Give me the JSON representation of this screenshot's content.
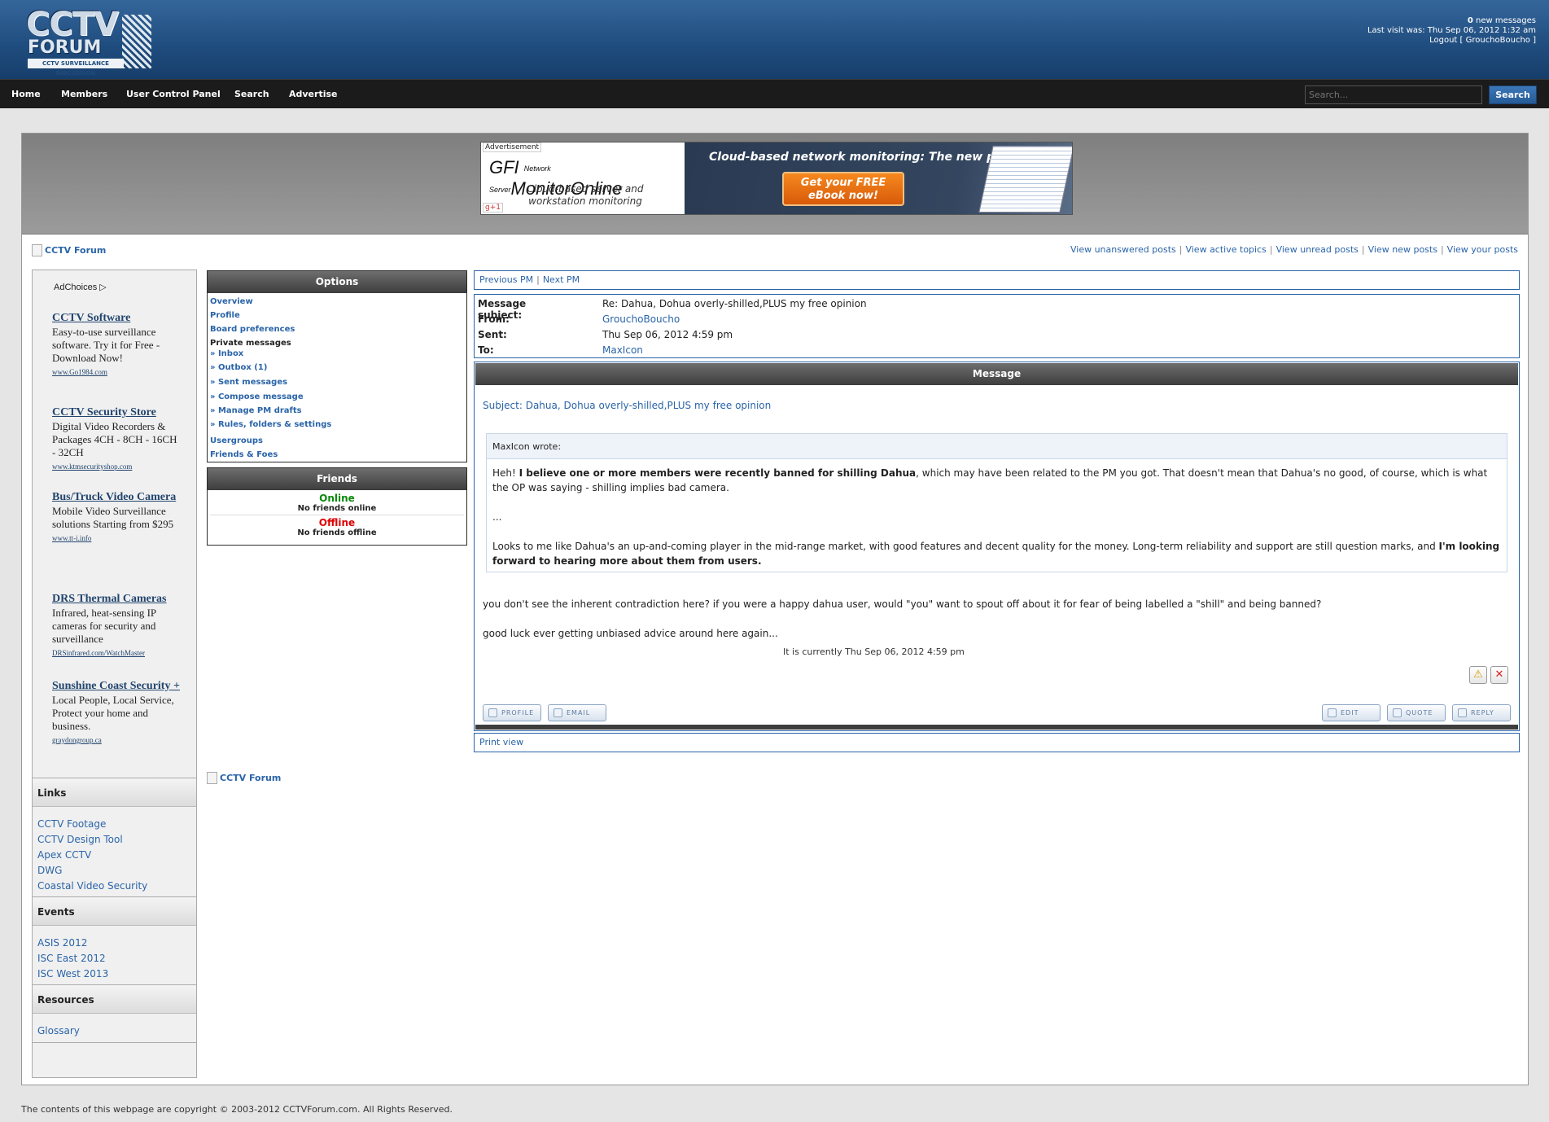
{
  "header": {
    "logo_main": "CCTV",
    "logo_sub": "FORUM",
    "logo_tag": "CCTV SURVEILLANCE DISCUSSION",
    "new_messages_count": "0",
    "new_messages_label": "new messages",
    "last_visit": "Last visit was: Thu Sep 06, 2012 1:32 am",
    "logout": "Logout [ GrouchoBoucho ]"
  },
  "nav": {
    "items": [
      "Home",
      "Members",
      "User Control Panel",
      "Search",
      "Advertise"
    ],
    "search_placeholder": "Search...",
    "search_button": "Search"
  },
  "ad_banner": {
    "label": "Advertisement",
    "brand_prefix": "GFI",
    "brand_small": "Network Server",
    "brand_name": "MonitorOnline",
    "subline": "Cloud-based server and workstation monitoring",
    "tagline": "Cloud-based network monitoring: The new paradigm",
    "cta": "Get your FREE eBook now!",
    "plus": "g+1"
  },
  "breadcrumb": "CCTV Forum",
  "top_links": [
    "View unanswered posts",
    "View active topics",
    "View unread posts",
    "View new posts",
    "View your posts"
  ],
  "sidebar": {
    "adchoices": "AdChoices",
    "ads": [
      {
        "title": "CCTV Software",
        "body": "Easy-to-use surveillance software. Try it for Free - Download Now!",
        "url": "www.Go1984.com"
      },
      {
        "title": "CCTV Security Store",
        "body": "Digital Video Recorders & Packages 4CH - 8CH - 16CH - 32CH",
        "url": "www.ktmsecurityshop.com"
      },
      {
        "title": "Bus/Truck Video Camera",
        "body": "Mobile Video Surveillance solutions Starting from $295",
        "url": "www.tt-i.info"
      },
      {
        "title": "DRS Thermal Cameras",
        "body": "Infrared, heat-sensing IP cameras for security and surveillance",
        "url": "DRSinfrared.com/WatchMaster"
      },
      {
        "title": "Sunshine Coast Security +",
        "body": "Local People, Local Service, Protect your home and business.",
        "url": "graydongroup.ca"
      }
    ],
    "links_title": "Links",
    "links": [
      "CCTV Footage",
      "CCTV Design Tool",
      "Apex CCTV",
      "DWG",
      "Coastal Video Security"
    ],
    "events_title": "Events",
    "events": [
      "ASIS 2012",
      "ISC East 2012",
      "ISC West 2013"
    ],
    "resources_title": "Resources",
    "resources": [
      "Glossary"
    ]
  },
  "options": {
    "title": "Options",
    "overview": "Overview",
    "profile": "Profile",
    "board_prefs": "Board preferences",
    "pm_label": "Private messages",
    "inbox": "» Inbox",
    "outbox": "» Outbox (1)",
    "sent": "» Sent messages",
    "compose": "» Compose message",
    "drafts": "» Manage PM drafts",
    "rules": "» Rules, folders & settings",
    "usergroups": "Usergroups",
    "friends_foes": "Friends & Foes"
  },
  "friends": {
    "title": "Friends",
    "online_label": "Online",
    "online_text": "No friends online",
    "offline_label": "Offline",
    "offline_text": "No friends offline",
    "online_color": "#0a8a0a",
    "offline_color": "#e00000"
  },
  "pm_nav": {
    "prev": "Previous PM",
    "next": "Next PM"
  },
  "message_meta": {
    "subject_label": "Message subject:",
    "subject": "Re: Dahua, Dohua overly-shilled,PLUS my free opinion",
    "from_label": "From:",
    "from": "GrouchoBoucho",
    "sent_label": "Sent:",
    "sent": "Thu Sep 06, 2012 4:59 pm",
    "to_label": "To:",
    "to": "MaxIcon"
  },
  "message": {
    "header": "Message",
    "subject_line": "Subject: Dahua, Dohua overly-shilled,PLUS my free opinion",
    "quote_author": "MaxIcon wrote:",
    "quote_p1_a": "Heh! ",
    "quote_p1_bold": "I believe one or more members were recently banned for shilling Dahua",
    "quote_p1_b": ", which may have been related to the PM you got. That doesn't mean that Dahua's no good, of course, which is what the OP was saying - shilling implies bad camera.",
    "quote_p2": "...",
    "quote_p3_a": "Looks to me like Dahua's an up-and-coming player in the mid-range market, with good features and decent quality for the money. Long-term reliability and support are still question marks, and ",
    "quote_p3_bold": "I'm looking forward to hearing more about them from users.",
    "reply_1": "you don't see the inherent contradiction here? if you were a happy dahua user, would \"you\" want to spout off about it for fear of being labelled a \"shill\" and being banned?",
    "reply_2": "good luck ever getting unbiased advice around here again..."
  },
  "buttons": {
    "profile": "PROFILE",
    "email": "EMAIL",
    "edit": "EDIT",
    "quote": "QUOTE",
    "reply": "REPLY"
  },
  "print_view": "Print view",
  "current_time": "It is currently Thu Sep 06, 2012 4:59 pm",
  "copyright": "The contents of this webpage are copyright © 2003-2012 CCTVForum.com. All Rights Reserved."
}
